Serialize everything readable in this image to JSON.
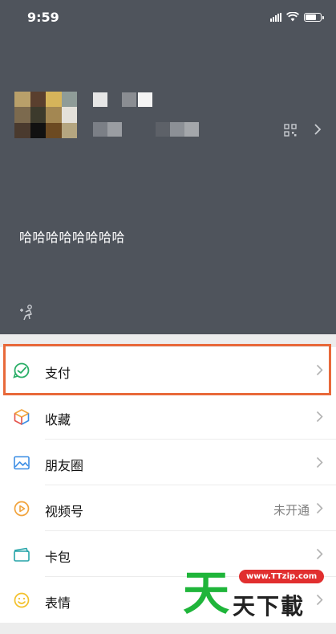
{
  "status_bar": {
    "time": "9:59",
    "icons": [
      "signal-icon",
      "wifi-icon",
      "battery-icon"
    ]
  },
  "profile": {
    "signature": "哈哈哈哈哈哈哈哈",
    "icons": [
      "qr-code-icon",
      "chevron-right-icon",
      "status-add-icon"
    ]
  },
  "menu": {
    "items": [
      {
        "label": "支付",
        "icon": "pay-icon",
        "value": "",
        "highlighted": true
      },
      {
        "label": "收藏",
        "icon": "favorites-icon",
        "value": ""
      },
      {
        "label": "朋友圈",
        "icon": "moments-icon",
        "value": ""
      },
      {
        "label": "视频号",
        "icon": "channels-icon",
        "value": "未开通"
      },
      {
        "label": "卡包",
        "icon": "cards-icon",
        "value": ""
      },
      {
        "label": "表情",
        "icon": "stickers-icon",
        "value": ""
      }
    ]
  },
  "colors": {
    "profile_bg": "#4f545c",
    "highlight_border": "#e8693a",
    "pay_green": "#2aae67",
    "watermark_green": "#1fb53a",
    "watermark_red": "#e12f2f"
  },
  "watermark": {
    "big_char": "天",
    "url": "www.TTzip.com",
    "text": "天下載"
  }
}
